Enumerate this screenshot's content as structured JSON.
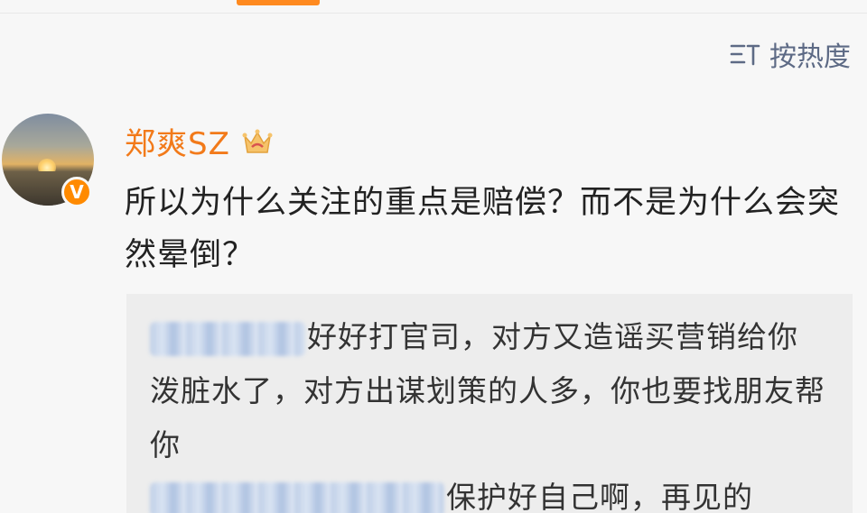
{
  "sort": {
    "label": "按热度",
    "icon": "sort-icon"
  },
  "comment": {
    "username": "郑爽SZ",
    "name_color": "#f27a1a",
    "badge_icon": "crown-vip-icon",
    "verified_icon": "verified-v-icon",
    "verified_mark": "V",
    "text": "所以为什么关注的重点是赔偿？而不是为什么会突然晕倒？"
  },
  "quoted_replies": [
    {
      "text": "好好打官司，对方又造谣买营销给你泼脏水了，对方出谋划策的人多，你也要找朋友帮你"
    },
    {
      "text": "保护好自己啊，再见的"
    }
  ],
  "colors": {
    "accent": "#ff8a1f",
    "link_blue": "#5d6a85"
  }
}
